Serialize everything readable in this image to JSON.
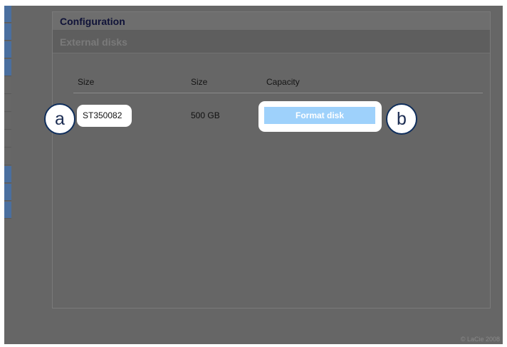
{
  "panel": {
    "title": "Configuration",
    "subtitle": "External disks"
  },
  "table": {
    "headers": [
      "Size",
      "Size",
      "Capacity"
    ],
    "row": {
      "name": "ST350082",
      "size": "500 GB",
      "action_label": "Format disk"
    }
  },
  "callouts": {
    "a": "a",
    "b": "b"
  },
  "footer": "© LaCie 2008",
  "colors": {
    "tab_blue": "#4a6f9f",
    "tab_gray": "#676767",
    "button_blue": "#9ed1fb",
    "title_navy": "#0f1238",
    "callout_ring": "#0f2e5c"
  },
  "left_tabs": [
    {
      "id": "tab-1",
      "color": "#4a6f9f"
    },
    {
      "id": "tab-2",
      "color": "#4a6f9f"
    },
    {
      "id": "tab-3",
      "color": "#4a6f9f"
    },
    {
      "id": "tab-4",
      "color": "#4a6f9f"
    },
    {
      "id": "tab-5",
      "color": "#676767"
    },
    {
      "id": "tab-6",
      "color": "#676767"
    },
    {
      "id": "tab-7",
      "color": "#676767"
    },
    {
      "id": "tab-8",
      "color": "#676767"
    },
    {
      "id": "tab-9",
      "color": "#676767"
    },
    {
      "id": "tab-10",
      "color": "#4a6f9f"
    },
    {
      "id": "tab-11",
      "color": "#4a6f9f"
    },
    {
      "id": "tab-12",
      "color": "#4a6f9f"
    }
  ]
}
